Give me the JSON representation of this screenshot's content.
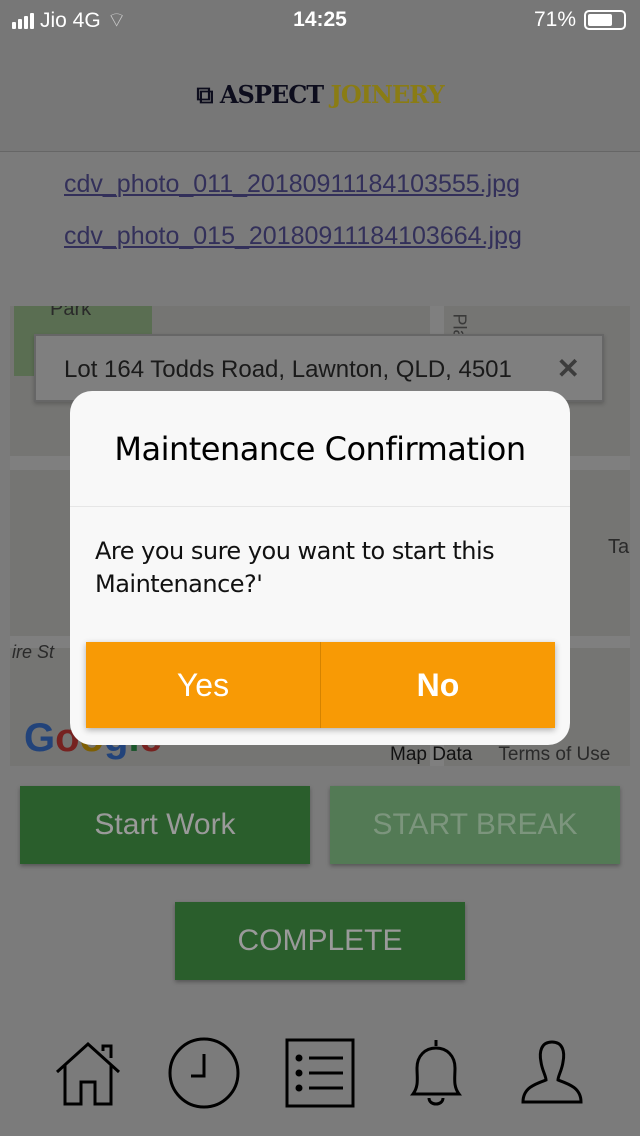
{
  "status_bar": {
    "carrier": "Jio 4G",
    "time": "14:25",
    "battery": "71%",
    "battery_level": 0.71
  },
  "header": {
    "logo_part1": "ASPECT",
    "logo_part2": "JOINERY"
  },
  "attachments": [
    "cdv_photo_011_20180911184103555.jpg",
    "cdv_photo_015_20180911184103664.jpg"
  ],
  "map": {
    "address": "Lot 164 Todds Road, Lawnton, QLD, 4501",
    "clear": "✕",
    "labels": [
      "Park",
      "Pla",
      "Ta",
      "ire St"
    ],
    "google": "Google",
    "map_data": "Map Data",
    "terms": "Terms of Use"
  },
  "actions": {
    "start_work": "Start Work",
    "start_break": "START BREAK",
    "complete": "COMPLETE"
  },
  "dialog": {
    "title": "Maintenance Confirmation",
    "message": "Are you sure you want to start this Maintenance?'",
    "yes": "Yes",
    "no": "No"
  },
  "nav": [
    "home-icon",
    "clock-icon",
    "list-icon",
    "bell-icon",
    "user-icon"
  ]
}
